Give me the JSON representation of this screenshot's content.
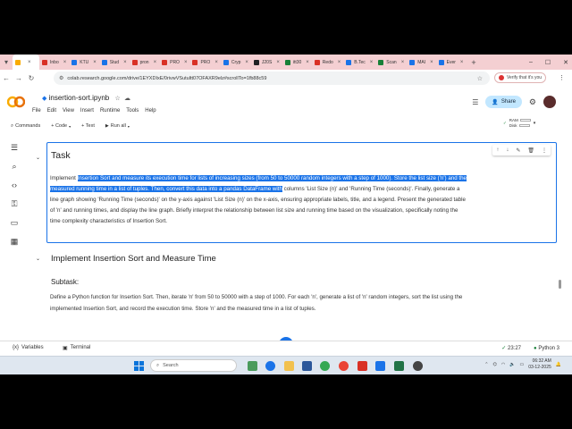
{
  "browser": {
    "tabs": [
      {
        "label": "",
        "color": "#f9ab00",
        "active": true
      },
      {
        "label": "Inbo",
        "color": "#d93025"
      },
      {
        "label": "KTU",
        "color": "#1a73e8"
      },
      {
        "label": "Stud",
        "color": "#1a73e8"
      },
      {
        "label": "pron",
        "color": "#d93025"
      },
      {
        "label": "PRO",
        "color": "#d93025"
      },
      {
        "label": "PRO",
        "color": "#d93025"
      },
      {
        "label": "Cryp",
        "color": "#1a73e8"
      },
      {
        "label": "J20S",
        "color": "#202124"
      },
      {
        "label": "itt30",
        "color": "#188038"
      },
      {
        "label": "Redo",
        "color": "#d93025"
      },
      {
        "label": "B.Tec",
        "color": "#1a73e8"
      },
      {
        "label": "Scan",
        "color": "#188038"
      },
      {
        "label": "MAI",
        "color": "#1a73e8"
      },
      {
        "label": "Ever",
        "color": "#1a73e8"
      }
    ],
    "new_tab": "+",
    "url": "colab.research.google.com/drive/1EYXDIxE/0rivwVSutultt07OFAXR9elz#scrollTo=1fb88c59",
    "verify_text": "Verify that it's you"
  },
  "colab": {
    "logo_text": "CO",
    "filename": "insertion-sort.ipynb",
    "menu": [
      "File",
      "Edit",
      "View",
      "Insert",
      "Runtime",
      "Tools",
      "Help"
    ],
    "share_label": "Share",
    "toolbar": {
      "commands": "Commands",
      "code": "+ Code",
      "text": "+ Text",
      "run_all": "Run all"
    },
    "ram_label": "RAM",
    "disk_label": "Disk"
  },
  "cells": {
    "task_title": "Task",
    "task_pre": "Implement ",
    "task_highlight": "Insertion Sort and measure its execution time for lists of increasing sizes (from 50 to 50000 random integers with a step of 1000). Store the list size ('n') and the measured running time in a list of tuples. Then, convert this data into a pandas DataFrame with",
    "task_post": " columns 'List Size (n)' and 'Running Time (seconds)'. Finally, generate a line graph showing 'Running Time (seconds)' on the y-axis against 'List Size (n)' on the x-axis, ensuring appropriate labels, title, and a legend. Present the generated table of 'n' and running times, and display the line graph. Briefly interpret the relationship between list size and running time based on the visualization, specifically noting the time complexity characteristics of Insertion Sort.",
    "section2_title": "Implement Insertion Sort and Measure Time",
    "subtask_title": "Subtask:",
    "subtask_body": "Define a Python function for Insertion Sort. Then, iterate 'n' from 50 to 50000 with a step of 1000. For each 'n', generate a list of 'n' random integers, sort the list using the implemented Insertion Sort, and record the execution time. Store 'n' and the measured time in a list of tuples."
  },
  "statusbar": {
    "variables": "Variables",
    "terminal": "Terminal",
    "time": "23:27",
    "runtime": "Python 3"
  },
  "taskbar": {
    "search_placeholder": "Search",
    "time": "06:32 AM",
    "date": "03-12-2025"
  }
}
